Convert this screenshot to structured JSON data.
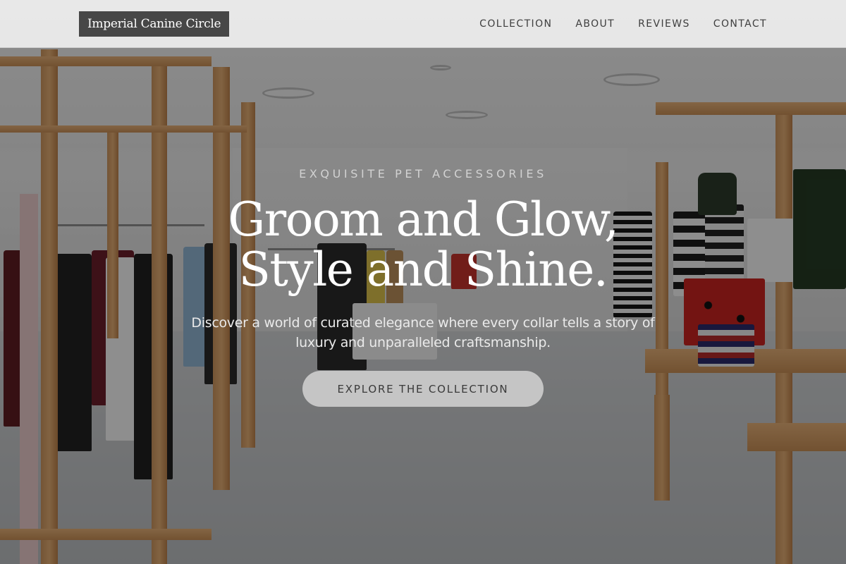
{
  "navbar": {
    "brand": "Imperial Canine Circle",
    "links": [
      "COLLECTION",
      "ABOUT",
      "REVIEWS",
      "CONTACT"
    ]
  },
  "hero": {
    "eyebrow": "EXQUISITE PET ACCESSORIES",
    "headline_line1": "Groom and Glow,",
    "headline_line2": "Style and Shine.",
    "subtext": "Discover a world of curated elegance where every collar tells a story of luxury and unparalleled craftsmanship.",
    "cta_label": "EXPLORE THE COLLECTION"
  },
  "colors": {
    "navbar_bg": "#ebebeb",
    "brand_bg": "#474747",
    "cta_bg": "#c5c5c5",
    "overlay": "rgba(0,0,0,0.42)"
  }
}
